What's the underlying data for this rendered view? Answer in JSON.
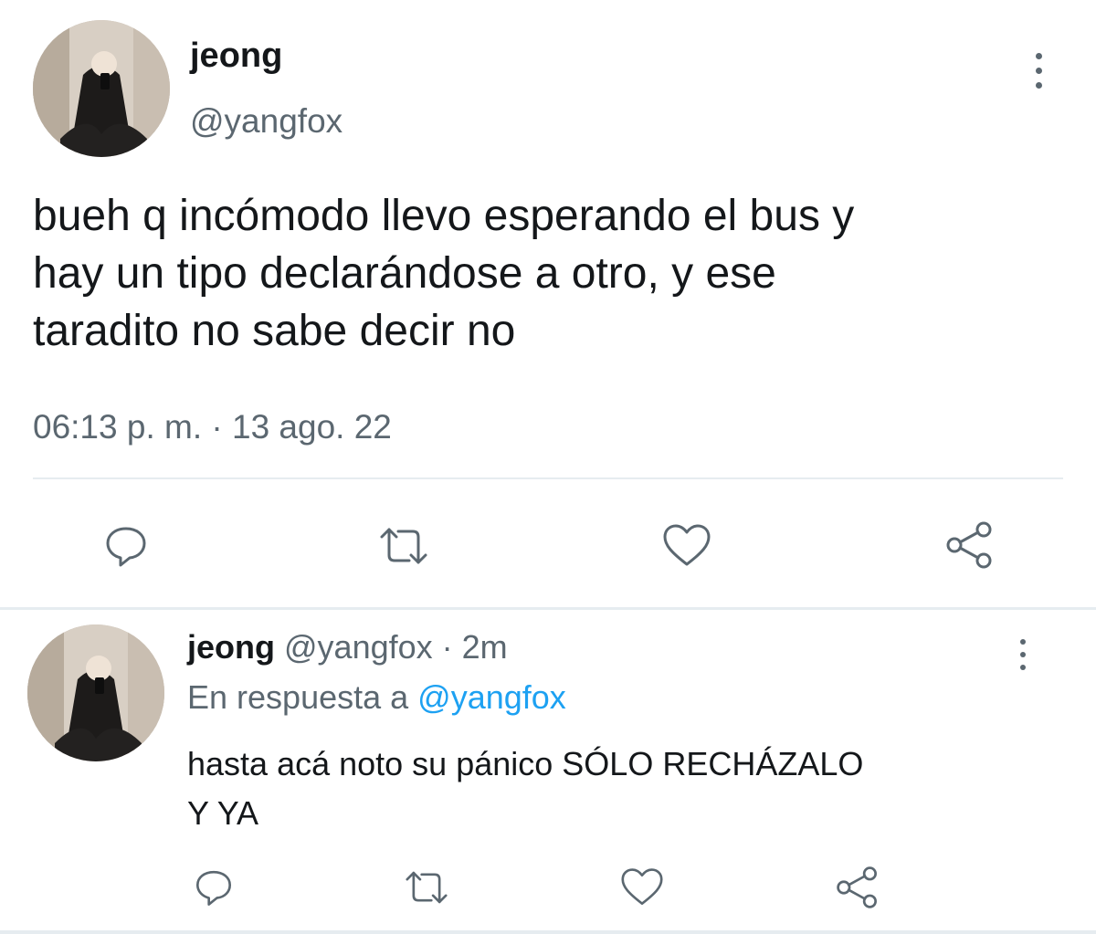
{
  "main_tweet": {
    "display_name": "jeong",
    "handle": "@yangfox",
    "text_lines": [
      "bueh q incómodo llevo esperando el bus y",
      "hay un tipo declarándose a otro, y ese",
      "taradito no sabe decir no"
    ],
    "timestamp": "06:13 p. m. · 13 ago. 22"
  },
  "reply_tweet": {
    "display_name": "jeong",
    "meta": "@yangfox · 2m",
    "reply_prefix": "En respuesta a",
    "reply_to": "@yangfox",
    "text_lines": [
      "hasta acá noto su pánico SÓLO RECHÁZALO",
      "Y YA"
    ]
  },
  "icons": [
    "more-vertical-icon",
    "reply-icon",
    "retweet-icon",
    "like-icon",
    "share-icon"
  ],
  "colors": {
    "text": "#14171a",
    "muted": "#5b6770",
    "link": "#1da1f2",
    "divider": "#e6ecf0"
  }
}
